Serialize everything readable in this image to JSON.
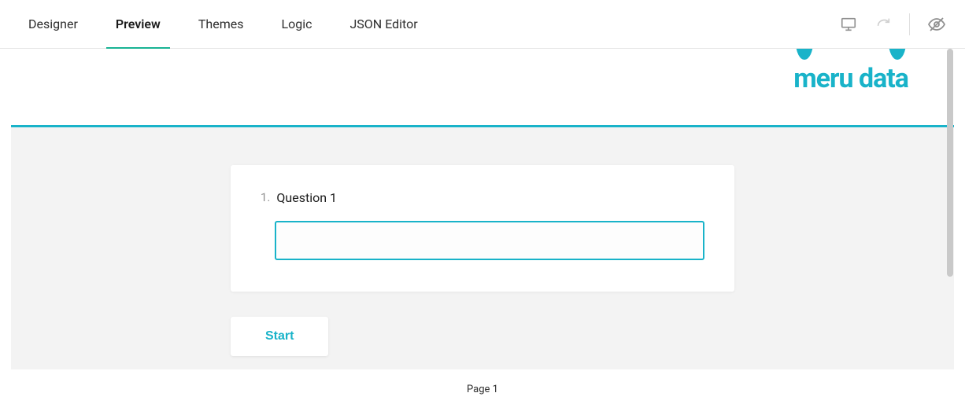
{
  "tabs": {
    "items": [
      {
        "label": "Designer"
      },
      {
        "label": "Preview"
      },
      {
        "label": "Themes"
      },
      {
        "label": "Logic"
      },
      {
        "label": "JSON Editor"
      }
    ],
    "activeIndex": 1
  },
  "logo": {
    "text": "meru data"
  },
  "survey": {
    "question": {
      "number": "1.",
      "title": "Question 1",
      "value": ""
    },
    "startButton": "Start"
  },
  "footer": {
    "pageLabel": "Page 1"
  }
}
